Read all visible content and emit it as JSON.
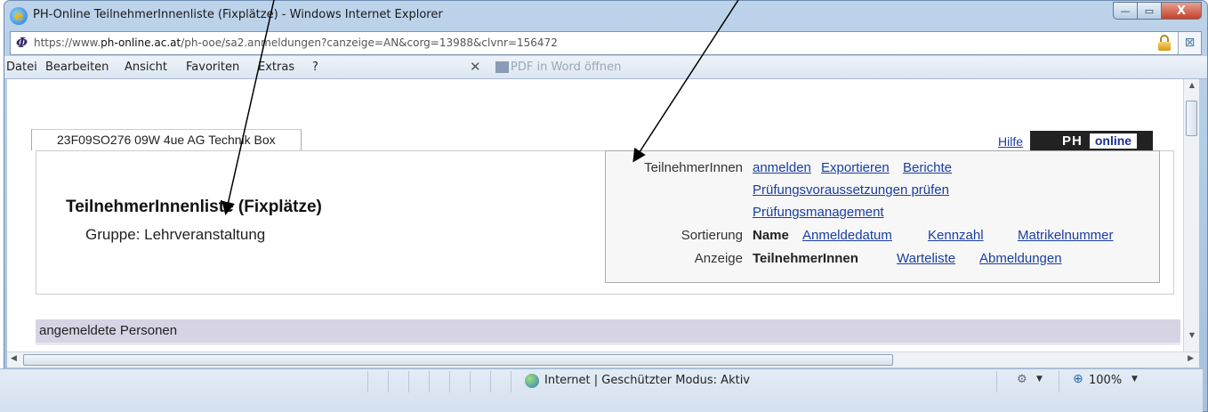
{
  "window": {
    "title": "PH-Online TeilnehmerInnenliste (Fixplätze) - Windows Internet Explorer",
    "minimize": "—",
    "maximize": "▭",
    "close": "X"
  },
  "address": {
    "url_prefix": "https://www.",
    "url_domain": "ph-online.ac.at",
    "url_rest": "/ph-ooe/sa2.anmeldungen?canzeige=AN&corg=13988&clvnr=156472"
  },
  "menu": {
    "items": [
      "Datei",
      "Bearbeiten",
      "Ansicht",
      "Favoriten",
      "Extras",
      "?"
    ],
    "pdf_label": "PDF in Word öffnen"
  },
  "page": {
    "course_tab": "23F09SO276 09W 4ue AG Technik Box",
    "help": "Hilfe",
    "logo_ph": "PH",
    "logo_online": "online",
    "title": "TeilnehmerInnenliste (Fixplätze)",
    "group": "Gruppe: Lehrveranstaltung",
    "options": {
      "participants_label": "TeilnehmerInnen",
      "participants_links": [
        "anmelden",
        "Exportieren",
        "Berichte"
      ],
      "check_link": "Prüfungsvoraussetzungen prüfen",
      "exam_link": "Prüfungsmanagement",
      "sort_label": "Sortierung",
      "sort_current": "Name",
      "sort_links": [
        "Anmeldedatum",
        "Kennzahl",
        "Matrikelnummer"
      ],
      "view_label": "Anzeige",
      "view_current": "TeilnehmerInnen",
      "view_links": [
        "Warteliste",
        "Abmeldungen"
      ]
    },
    "section_title": "angemeldete Personen"
  },
  "status": {
    "zone": "Internet | Geschützter Modus: Aktiv",
    "zoom": "100%"
  }
}
